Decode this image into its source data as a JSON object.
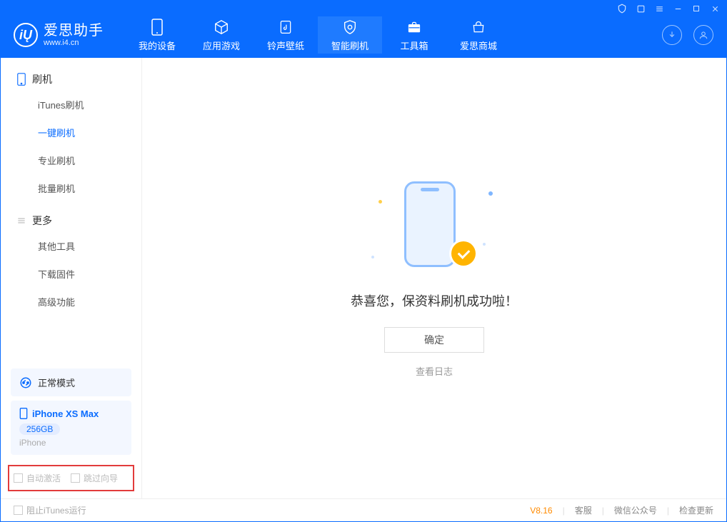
{
  "app": {
    "name": "爱思助手",
    "url": "www.i4.cn"
  },
  "tabs": [
    {
      "label": "我的设备"
    },
    {
      "label": "应用游戏"
    },
    {
      "label": "铃声壁纸"
    },
    {
      "label": "智能刷机"
    },
    {
      "label": "工具箱"
    },
    {
      "label": "爱思商城"
    }
  ],
  "sidebar": {
    "group1": {
      "title": "刷机",
      "items": [
        "iTunes刷机",
        "一键刷机",
        "专业刷机",
        "批量刷机"
      ]
    },
    "group2": {
      "title": "更多",
      "items": [
        "其他工具",
        "下载固件",
        "高级功能"
      ]
    }
  },
  "mode": {
    "label": "正常模式"
  },
  "device": {
    "name": "iPhone XS Max",
    "capacity": "256GB",
    "subtitle": "iPhone"
  },
  "options": {
    "auto_activate": "自动激活",
    "skip_guide": "跳过向导"
  },
  "content": {
    "success_text": "恭喜您，保资料刷机成功啦！",
    "ok_button": "确定",
    "view_log": "查看日志"
  },
  "footer": {
    "block_itunes": "阻止iTunes运行",
    "version": "V8.16",
    "links": [
      "客服",
      "微信公众号",
      "检查更新"
    ]
  }
}
